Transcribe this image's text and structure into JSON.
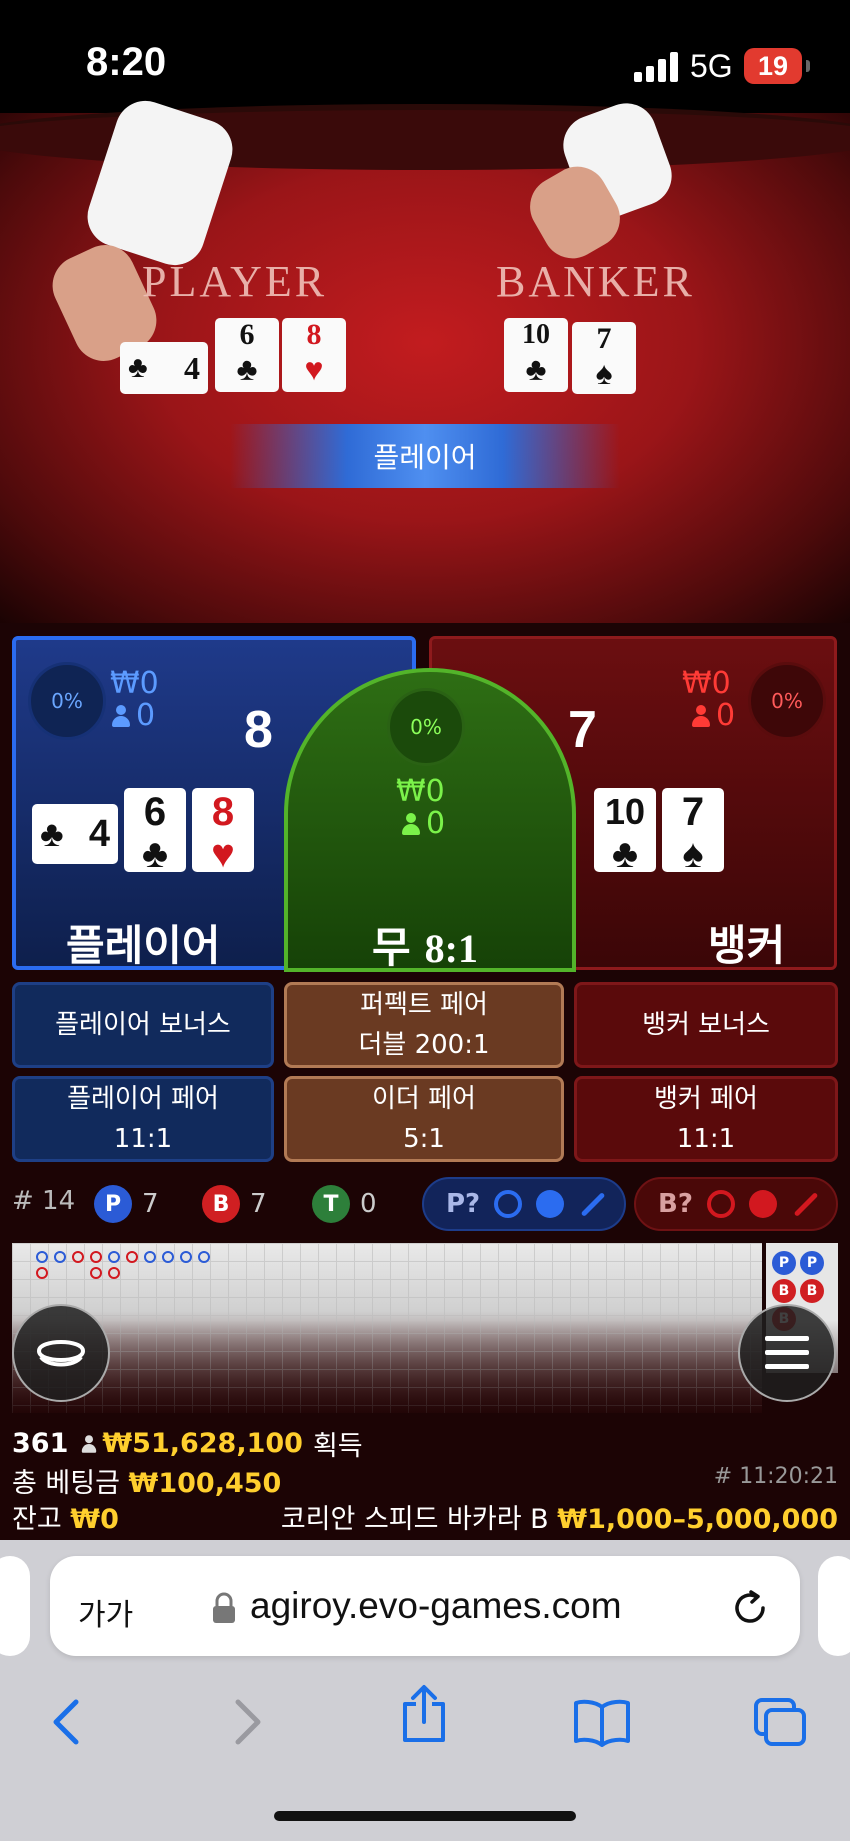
{
  "status_bar": {
    "time": "8:20",
    "network": "5G",
    "battery": "19"
  },
  "table": {
    "player_label": "PLAYER",
    "banker_label": "BANKER",
    "winner_banner": "플레이어",
    "player_cards": [
      {
        "rank": "4",
        "suit": "♣",
        "color": "black"
      },
      {
        "rank": "6",
        "suit": "♣",
        "color": "black"
      },
      {
        "rank": "8",
        "suit": "♥",
        "color": "red"
      }
    ],
    "banker_cards": [
      {
        "rank": "10",
        "suit": "♣",
        "color": "black"
      },
      {
        "rank": "7",
        "suit": "♠",
        "color": "black"
      }
    ]
  },
  "bet": {
    "player": {
      "pct": "0%",
      "amount": "₩0",
      "bettors": "0",
      "score": "8",
      "name": "플레이어",
      "cards": [
        {
          "rank": "4",
          "suit": "♣",
          "color": "black"
        },
        {
          "rank": "6",
          "suit": "♣",
          "color": "black"
        },
        {
          "rank": "8",
          "suit": "♥",
          "color": "red"
        }
      ]
    },
    "tie": {
      "pct": "0%",
      "amount": "₩0",
      "bettors": "0",
      "name": "무",
      "odds": "8:1"
    },
    "banker": {
      "pct": "0%",
      "amount": "₩0",
      "bettors": "0",
      "score": "7",
      "name": "뱅커",
      "cards": [
        {
          "rank": "10",
          "suit": "♣",
          "color": "black"
        },
        {
          "rank": "7",
          "suit": "♠",
          "color": "black"
        }
      ]
    }
  },
  "side_bets": {
    "player_bonus": "플레이어 보너스",
    "perfect_pair": {
      "line1": "퍼펙트 페어",
      "line2": "더블 200:1"
    },
    "banker_bonus": "뱅커 보너스",
    "player_pair": {
      "line1": "플레이어 페어",
      "line2": "11:1"
    },
    "either_pair": {
      "line1": "이더 페어",
      "line2": "5:1"
    },
    "banker_pair": {
      "line1": "뱅커 페어",
      "line2": "11:1"
    }
  },
  "stats": {
    "round": "# 14",
    "p_label": "P",
    "p_count": "7",
    "b_label": "B",
    "b_count": "7",
    "t_label": "T",
    "t_count": "0",
    "p_predict": "P?",
    "b_predict": "B?"
  },
  "road_side_labels": [
    "P",
    "P",
    "B",
    "B",
    "B"
  ],
  "footer": {
    "players": "361",
    "winnings": "₩51,628,100",
    "winnings_suffix": "획득",
    "total_bet_label": "총 베팅금",
    "total_bet": "₩100,450",
    "round_id": "# 11:20:21",
    "balance_label": "잔고",
    "balance": "₩0",
    "table_name": "코리안 스피드 바카라 B",
    "limits": "₩1,000–5,000,000"
  },
  "browser": {
    "text_size": "가가",
    "url": "agiroy.evo-games.com"
  },
  "colors": {
    "player": "#2b6cf0",
    "banker": "#d2181f",
    "tie": "#53b42a",
    "gold": "#ffcf2e"
  }
}
